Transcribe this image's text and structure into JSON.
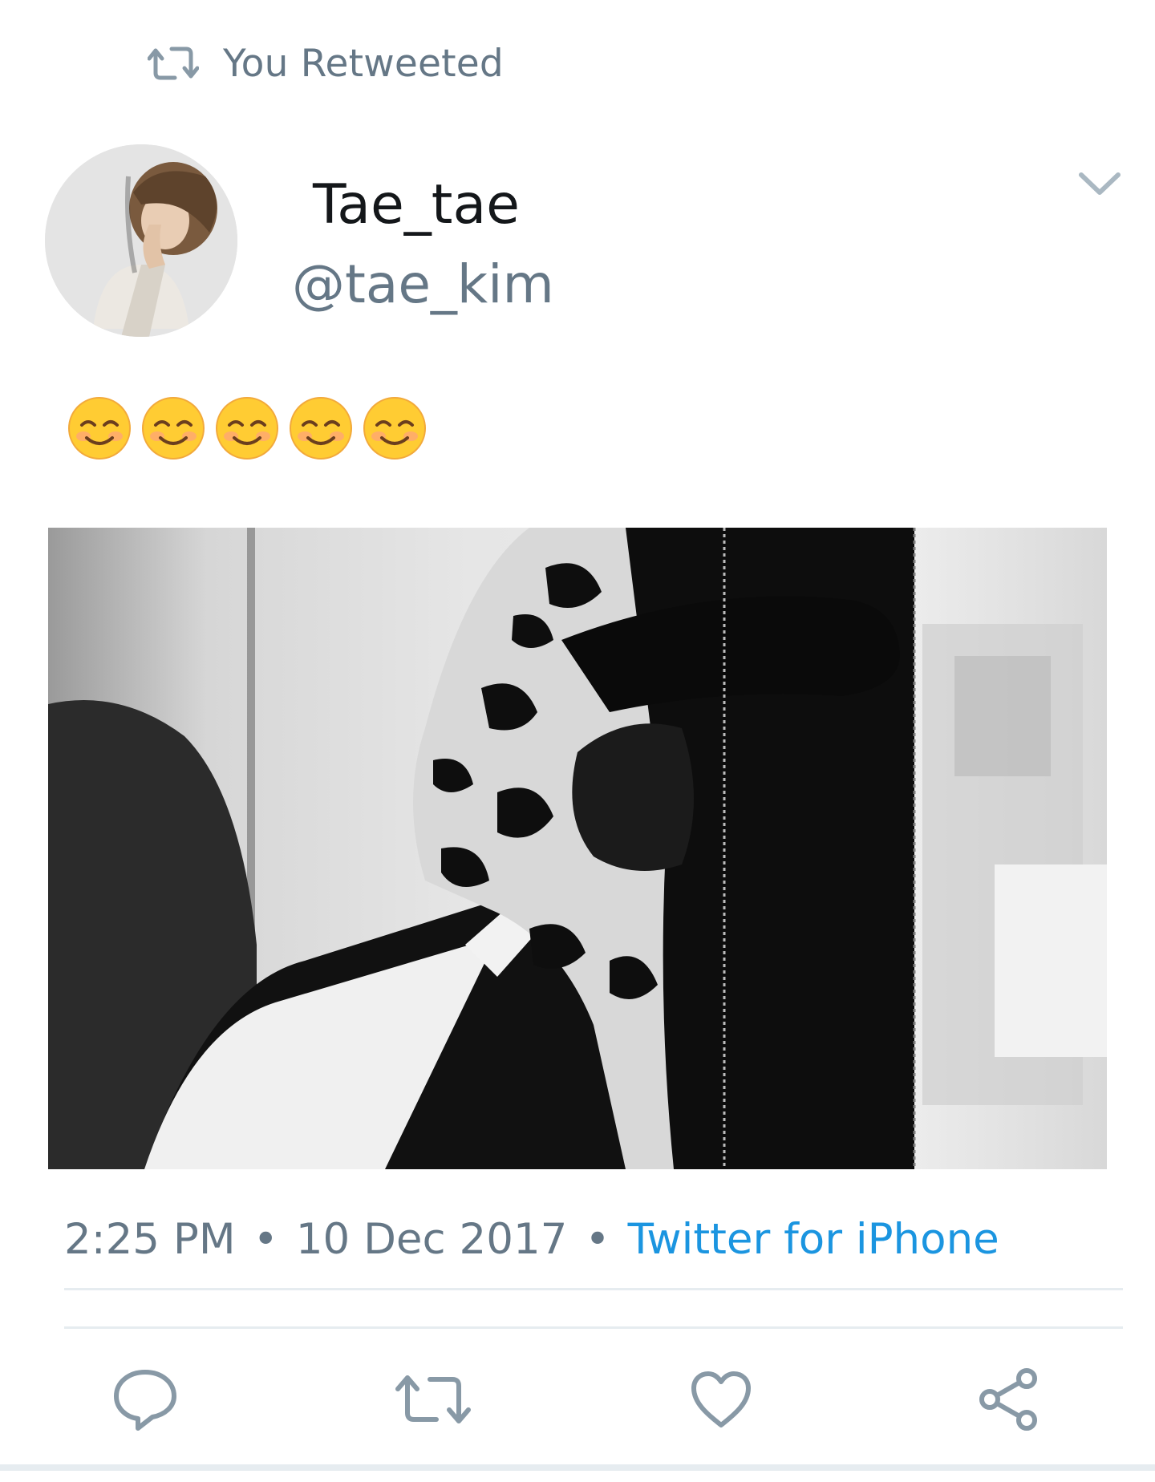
{
  "retweet_context": {
    "icon": "retweet-icon",
    "label": "You Retweeted"
  },
  "author": {
    "display_name": "Tae_tae",
    "handle": "@tae_kim",
    "avatar": "avatar-photo"
  },
  "tweet": {
    "emoji": [
      "smiling-face-with-smiling-eyes",
      "smiling-face-with-smiling-eyes",
      "smiling-face-with-smiling-eyes",
      "smiling-face-with-smiling-eyes",
      "smiling-face-with-smiling-eyes"
    ],
    "media": "photo-black-and-white-hooded-figure"
  },
  "meta": {
    "time": "2:25 PM",
    "separator": "•",
    "date": "10 Dec 2017",
    "source": "Twitter for iPhone"
  },
  "actions": {
    "reply_icon": "reply-icon",
    "retweet_icon": "retweet-icon",
    "like_icon": "heart-icon",
    "share_icon": "share-icon"
  },
  "colors": {
    "secondary_text": "#657786",
    "primary_text": "#14171a",
    "link": "#1b95e0",
    "divider": "#e6ecf0",
    "icon": "#8899a6"
  }
}
